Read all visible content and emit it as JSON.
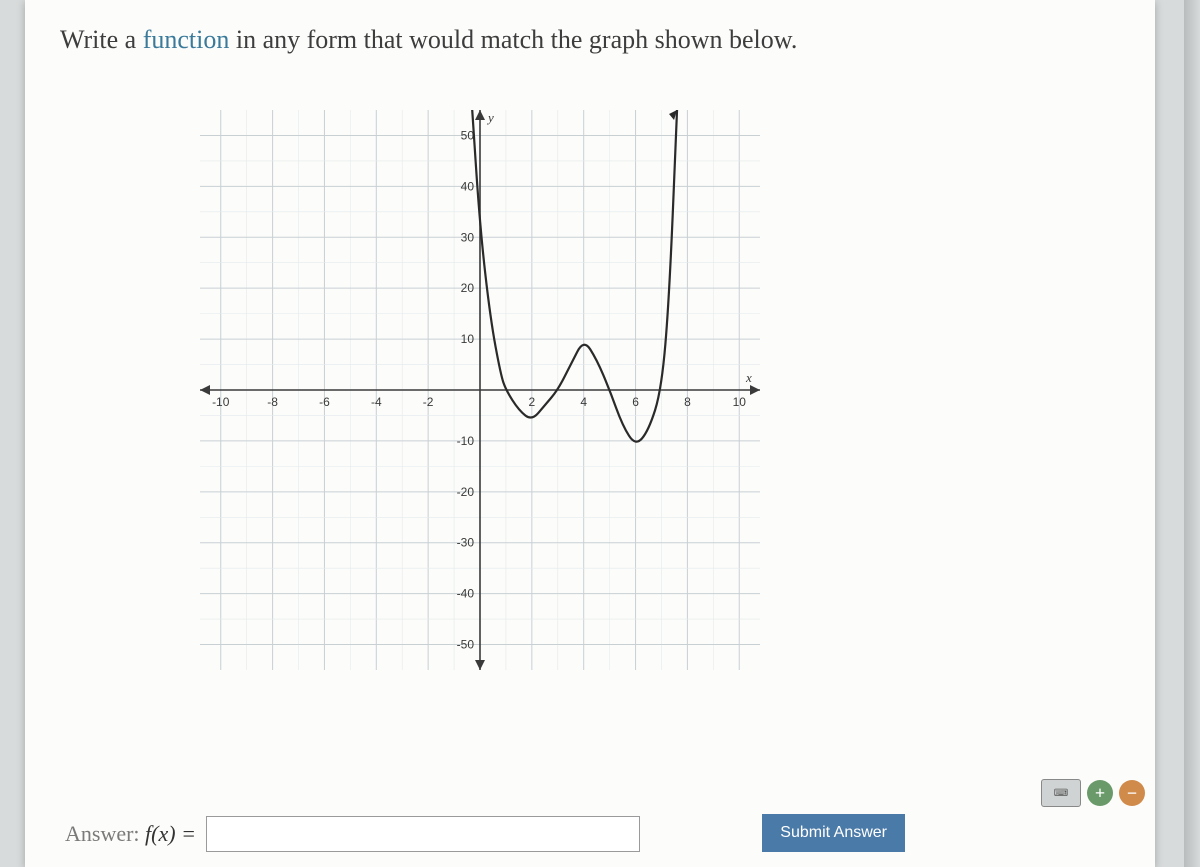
{
  "prompt": {
    "pre": "Write a ",
    "kw": "function",
    "post": " in any form that would match the graph shown below."
  },
  "answer": {
    "label_pre": "Answer: ",
    "fx": "f(x) =",
    "placeholder": ""
  },
  "submit_label": "Submit Answer",
  "chart_data": {
    "type": "line",
    "xlabel": "x",
    "ylabel": "y",
    "x_ticks": [
      -10,
      -8,
      -6,
      -4,
      -2,
      2,
      4,
      6,
      8,
      10
    ],
    "y_ticks": [
      50,
      40,
      30,
      20,
      10,
      -10,
      -20,
      -30,
      -40,
      -50
    ],
    "xlim": [
      -10.8,
      10.8
    ],
    "ylim": [
      -55,
      55
    ],
    "grid": true,
    "note": "Polynomial curve with roots at x≈1, x≈3, x≈5, x≈7; negative leading behavior left of 0 heading sharply upward; curve rises steeply past x≈7.",
    "series": [
      {
        "name": "f(x)",
        "x": [
          -0.3,
          0.0,
          0.4,
          0.8,
          1.0,
          1.5,
          2.0,
          2.5,
          3.0,
          3.5,
          4.0,
          4.5,
          5.0,
          5.5,
          6.0,
          6.5,
          7.0,
          7.3,
          7.6
        ],
        "y": [
          55,
          32,
          14,
          3,
          0,
          -4,
          -6,
          -3,
          0,
          5,
          10,
          6,
          0,
          -7,
          -11,
          -8,
          0,
          18,
          55
        ]
      }
    ]
  }
}
